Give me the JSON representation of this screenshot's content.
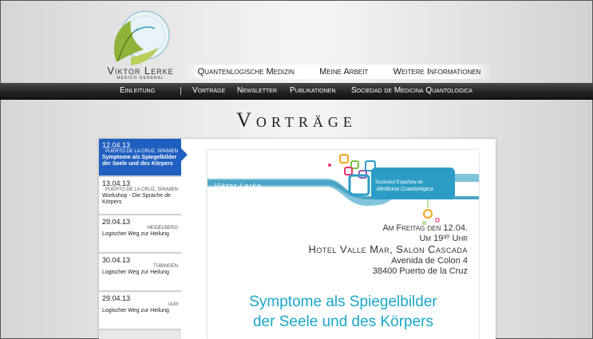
{
  "brand": {
    "name": "Viktor Lerke",
    "subtitle": "Medico General"
  },
  "main_nav": [
    "Quantenlogische Medizin",
    "Meine Arbeit",
    "Weitere Informationen"
  ],
  "sub_nav": [
    "Einleitung",
    "Vorträge",
    "Newsletter",
    "Publikationen",
    "Sociedad de Medicina Quantologica"
  ],
  "page_title": "Vorträge",
  "events": [
    {
      "date": "12.04.13",
      "location": "Puerto de la Cruz, Spanien",
      "title": "Symptome als Spiegelbilder der Seele und des Körpers"
    },
    {
      "date": "13.04.13",
      "location": "Puerto de la Cruz, Spanien",
      "title": "Workshop - Die Sprache de Körpers"
    },
    {
      "date": "29.04.13",
      "location": "Heidelberg",
      "title": "Logischer Weg zur Heilung"
    },
    {
      "date": "30.04.13",
      "location": "Tübingen",
      "title": "Logischer Weg zur Heilung"
    },
    {
      "date": "29.04.13",
      "location": "Ulm",
      "title": "Logischer Weg zur Heilung"
    }
  ],
  "flyer": {
    "name": "Viktor Lerke",
    "role": "Presidente / Medico General",
    "society_line1": "Sociedad Española de",
    "society_line2": "Medicina Cuantológica",
    "date_line": "Am Freitag den 12.04.",
    "time_line": "Um 19³⁰ Uhr",
    "venue_line": "Hotel Valle Mar, Salon Cascada",
    "street_line": "Avenida de Colon 4",
    "city_line": "38400 Puerto de la Cruz",
    "headline_1": "Symptome als Spiegelbilder",
    "headline_2": "der Seele und des Körpers"
  },
  "colors": {
    "accent_blue": "#1f5fbf",
    "teal": "#1aa6c8",
    "nav_dark": "#222222"
  }
}
